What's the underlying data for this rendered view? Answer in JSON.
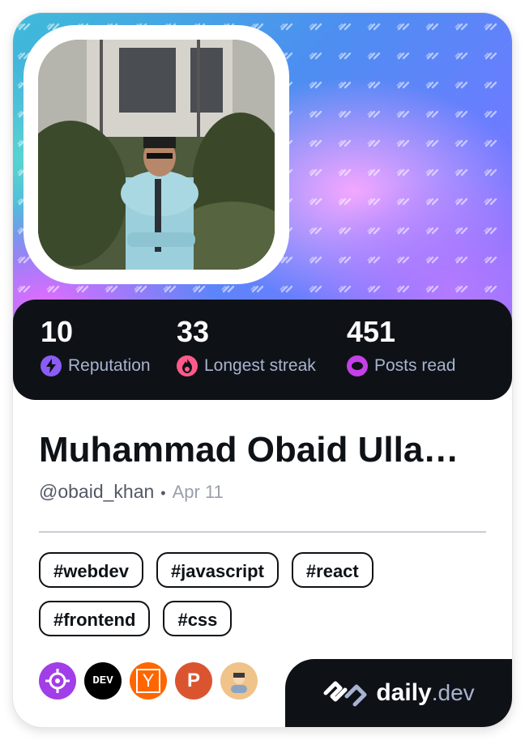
{
  "profile": {
    "name": "Muhammad Obaid Ulla…",
    "handle": "@obaid_khan",
    "separator": "•",
    "date": "Apr 11"
  },
  "stats": [
    {
      "value": "10",
      "label": "Reputation",
      "icon": "bolt-icon",
      "color": "#8b5cf6"
    },
    {
      "value": "33",
      "label": "Longest streak",
      "icon": "flame-icon",
      "color": "#ff5a8a"
    },
    {
      "value": "451",
      "label": "Posts read",
      "icon": "eye-icon",
      "color": "#c63fe8"
    }
  ],
  "tags": [
    "#webdev",
    "#javascript",
    "#react",
    "#frontend",
    "#css"
  ],
  "sources": [
    {
      "name": "crosshair-source-icon",
      "color": "#a13ee8"
    },
    {
      "name": "dev-source-icon",
      "text": "DEV",
      "color": "#000000"
    },
    {
      "name": "ycombinator-source-icon",
      "text": "Y",
      "color": "#ff6600"
    },
    {
      "name": "producthunt-source-icon",
      "text": "P",
      "color": "#da552f"
    },
    {
      "name": "user-avatar-source-icon",
      "color": "#f0c38a"
    }
  ],
  "brand": {
    "daily": "daily",
    "dev": ".dev"
  }
}
